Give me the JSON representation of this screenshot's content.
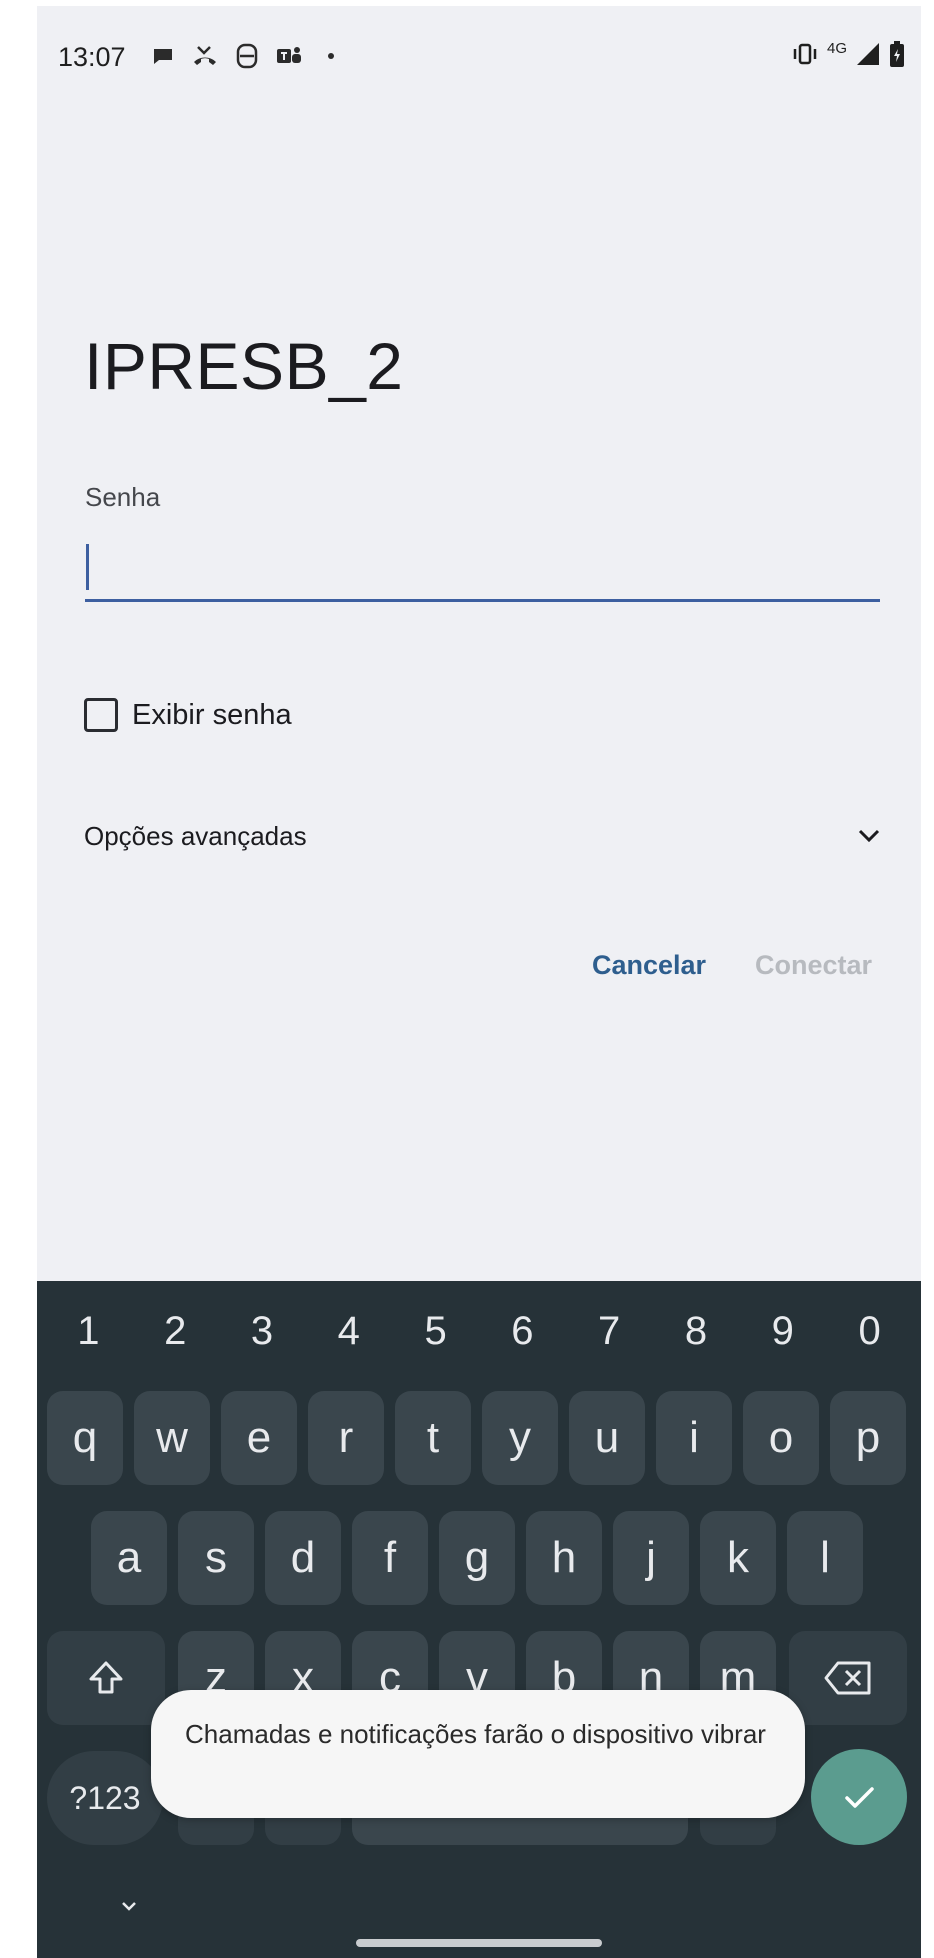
{
  "status_bar": {
    "time": "13:07",
    "left_icons": [
      "chat-bubble-icon",
      "missed-call-icon",
      "s-app-icon",
      "teams-icon",
      "dot-icon"
    ],
    "right_icons": [
      "vibrate-icon",
      "network-4g-icon",
      "signal-icon",
      "battery-icon"
    ],
    "network": "4G"
  },
  "dialog": {
    "title": "IPRESB_2",
    "password_label": "Senha",
    "password_value": "",
    "show_password_label": "Exibir senha",
    "show_password_checked": false,
    "advanced_label": "Opções avançadas",
    "cancel_label": "Cancelar",
    "connect_label": "Conectar"
  },
  "keyboard": {
    "number_row": [
      "1",
      "2",
      "3",
      "4",
      "5",
      "6",
      "7",
      "8",
      "9",
      "0"
    ],
    "row1": [
      "q",
      "w",
      "e",
      "r",
      "t",
      "y",
      "u",
      "i",
      "o",
      "p"
    ],
    "row2": [
      "a",
      "s",
      "d",
      "f",
      "g",
      "h",
      "j",
      "k",
      "l"
    ],
    "row3": [
      "z",
      "x",
      "c",
      "v",
      "b",
      "n",
      "m"
    ],
    "symbols_label": "?123",
    "enter_icon": "check-icon",
    "shift_icon": "shift-icon",
    "backspace_icon": "backspace-icon"
  },
  "toast": {
    "message": "Chamadas e notificações farão o dispositivo vibrar"
  },
  "colors": {
    "accent": "#2e5e8e",
    "input_underline": "#3d5fa0",
    "keyboard_bg": "#263238",
    "enter_key": "#5b9c8f",
    "disabled_text": "#b7babf"
  }
}
